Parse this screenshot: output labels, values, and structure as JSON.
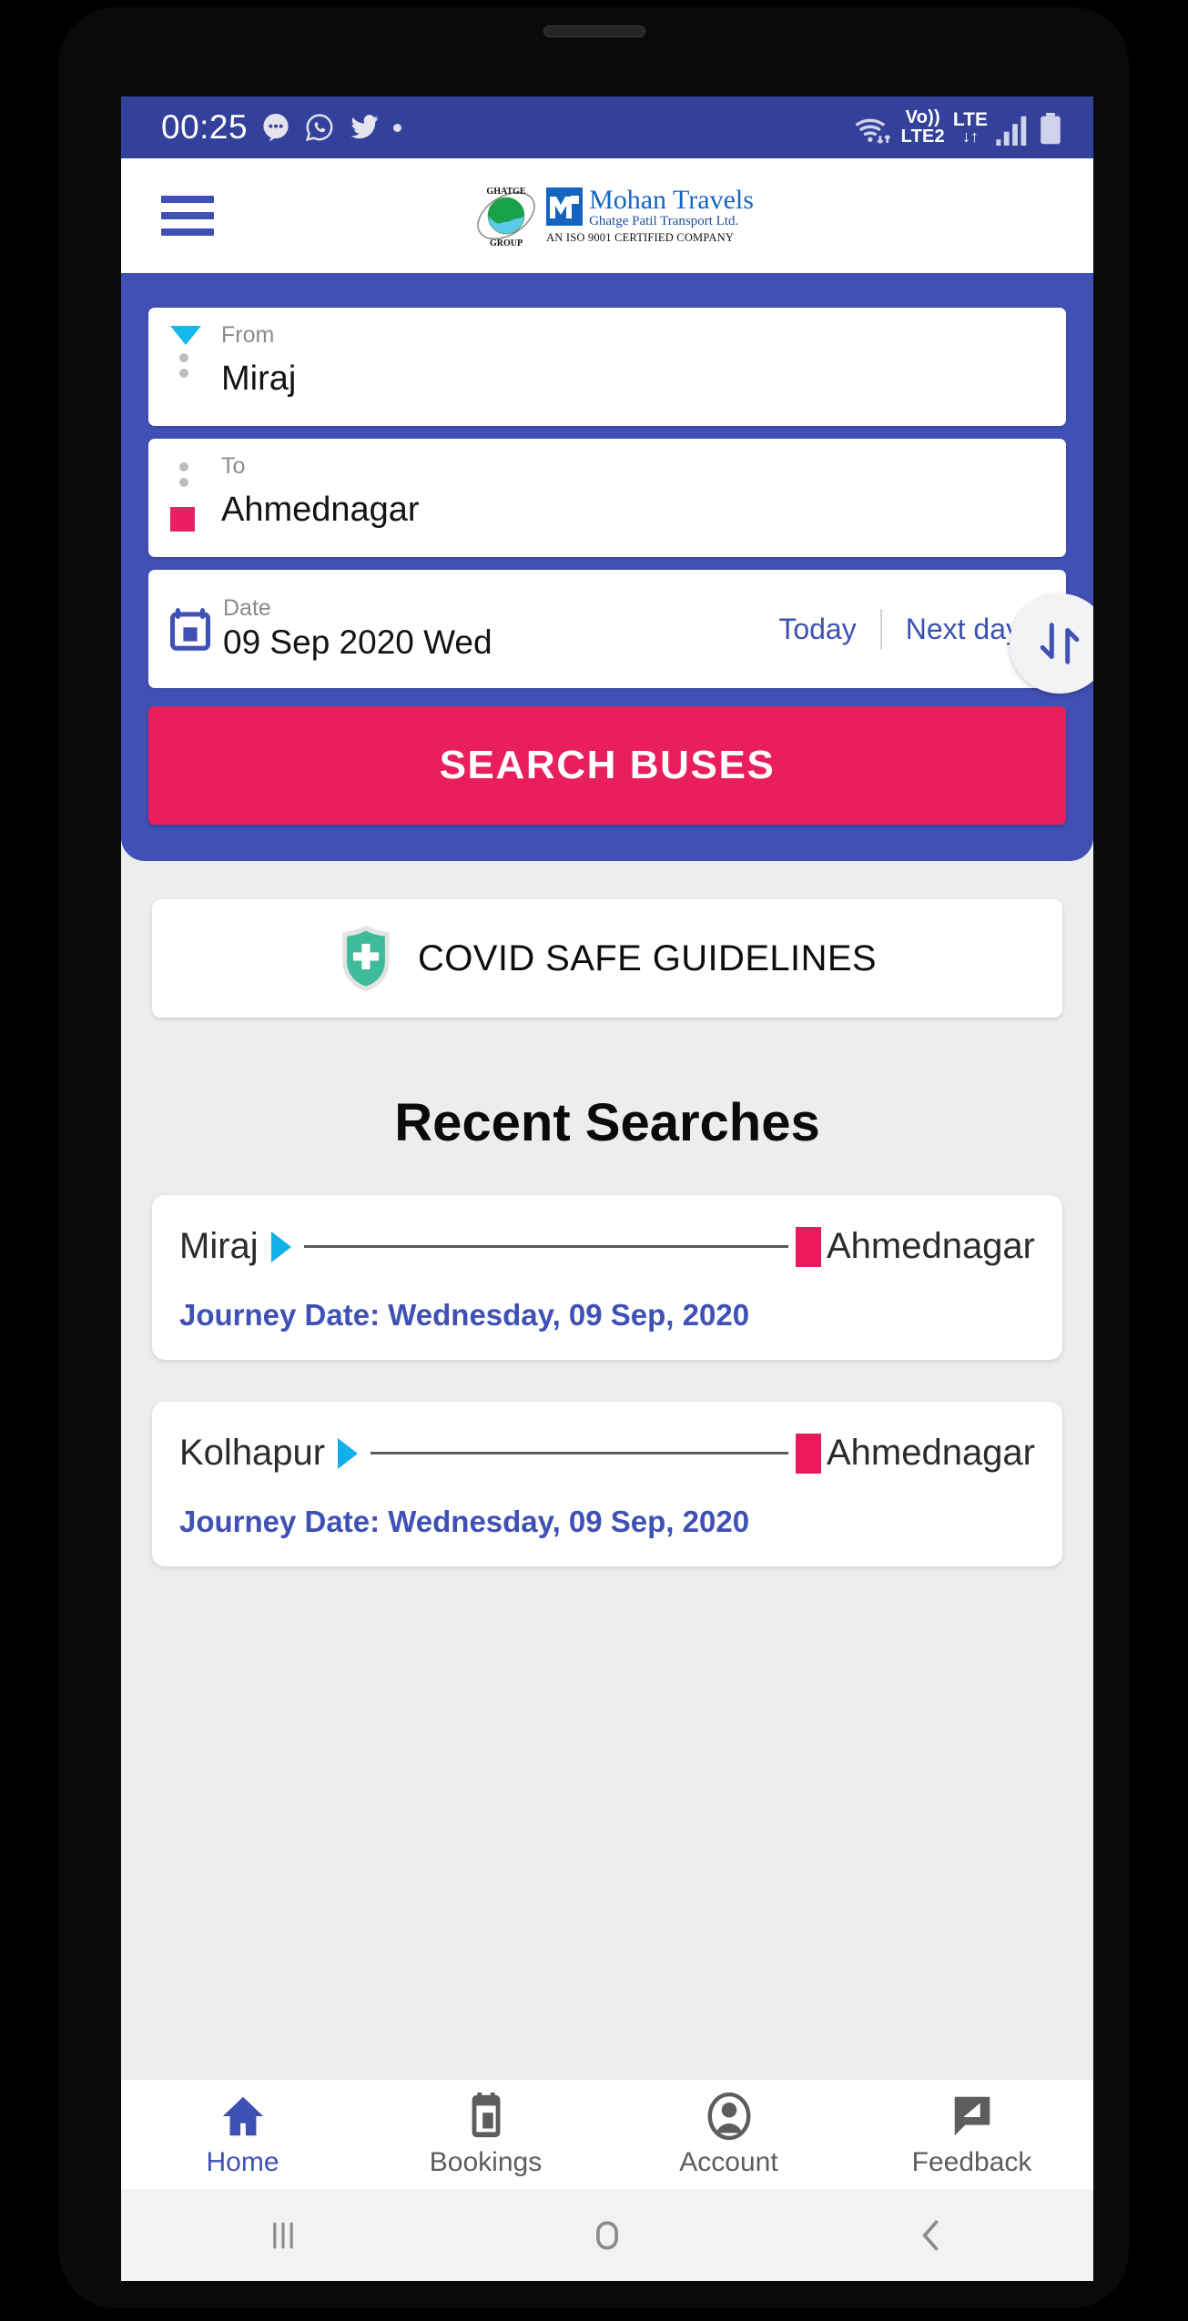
{
  "status_bar": {
    "time": "00:25",
    "left_icons": [
      "messages-icon",
      "whatsapp-icon",
      "twitter-icon",
      "notification-dot"
    ],
    "network": {
      "volte_top": "Vo))",
      "volte_bottom": "LTE2",
      "lte_top": "LTE",
      "lte_bottom": "↓↑"
    },
    "right_icons": [
      "wifi-icon",
      "volte-icon",
      "lte-icon",
      "signal-bars-icon",
      "battery-icon"
    ],
    "background": "#34419b"
  },
  "app_bar": {
    "menu_icon": "hamburger-menu-icon",
    "logo": {
      "group_text_top": "GHATGE",
      "group_text_bottom": "GROUP",
      "brand": "Mohan Travels",
      "subtitle": "Ghatge Patil Transport Ltd.",
      "certification": "AN ISO 9001 CERTIFIED COMPANY"
    }
  },
  "search_panel": {
    "background": "#4050b5",
    "from": {
      "label": "From",
      "value": "Miraj",
      "icon": "triangle-down-icon",
      "icon_color": "#12b8ea"
    },
    "to": {
      "label": "To",
      "value": "Ahmednagar",
      "icon": "square-icon",
      "icon_color": "#e91e63"
    },
    "swap_icon": "swap-vertical-arrows-icon",
    "date": {
      "label": "Date",
      "value": "09 Sep 2020 Wed",
      "icon": "calendar-icon",
      "today_label": "Today",
      "next_day_label": "Next day"
    },
    "search_button": {
      "label": "SEARCH BUSES",
      "color": "#e91e5c"
    }
  },
  "covid_card": {
    "label": "COVID SAFE GUIDELINES",
    "icon": "shield-cross-icon",
    "icon_color": "#3dbb9a"
  },
  "recent_searches": {
    "title": "Recent Searches",
    "items": [
      {
        "origin": "Miraj",
        "destination": "Ahmednagar",
        "journey_date": "Journey Date: Wednesday, 09 Sep, 2020"
      },
      {
        "origin": "Kolhapur",
        "destination": "Ahmednagar",
        "journey_date": "Journey Date: Wednesday, 09 Sep, 2020"
      }
    ]
  },
  "tab_bar": {
    "active": "Home",
    "tabs": [
      {
        "label": "Home",
        "icon": "home-icon"
      },
      {
        "label": "Bookings",
        "icon": "ticket-icon"
      },
      {
        "label": "Account",
        "icon": "person-circle-icon"
      },
      {
        "label": "Feedback",
        "icon": "feedback-pencil-icon"
      }
    ]
  },
  "nav_bar": {
    "buttons": [
      {
        "icon": "recents-icon"
      },
      {
        "icon": "home-circle-icon"
      },
      {
        "icon": "back-chevron-icon"
      }
    ]
  }
}
